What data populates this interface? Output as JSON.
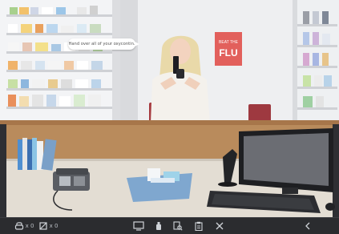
{
  "scene": {
    "speech_bubble": "Hand over all of your oxycontin.",
    "poster": {
      "line1": "BEAT THE",
      "line2": "FLU"
    }
  },
  "hud": {
    "left": [
      {
        "icon": "handcuffs-icon",
        "count": "x 0"
      },
      {
        "icon": "no-drug-icon",
        "count": "x 0"
      }
    ],
    "center": [
      "monitor-icon",
      "inhaler-icon",
      "search-document-icon",
      "clipboard-icon",
      "close-icon"
    ],
    "right": "back-arrow-icon"
  },
  "colors": {
    "wall": "#e9eaec",
    "counter_wood": "#b98b5c",
    "counter_top": "#e3ddd3",
    "poster_red": "#e2605c",
    "hud_bg": "#2b2c2f",
    "tray_blue": "#7fa7cf"
  }
}
